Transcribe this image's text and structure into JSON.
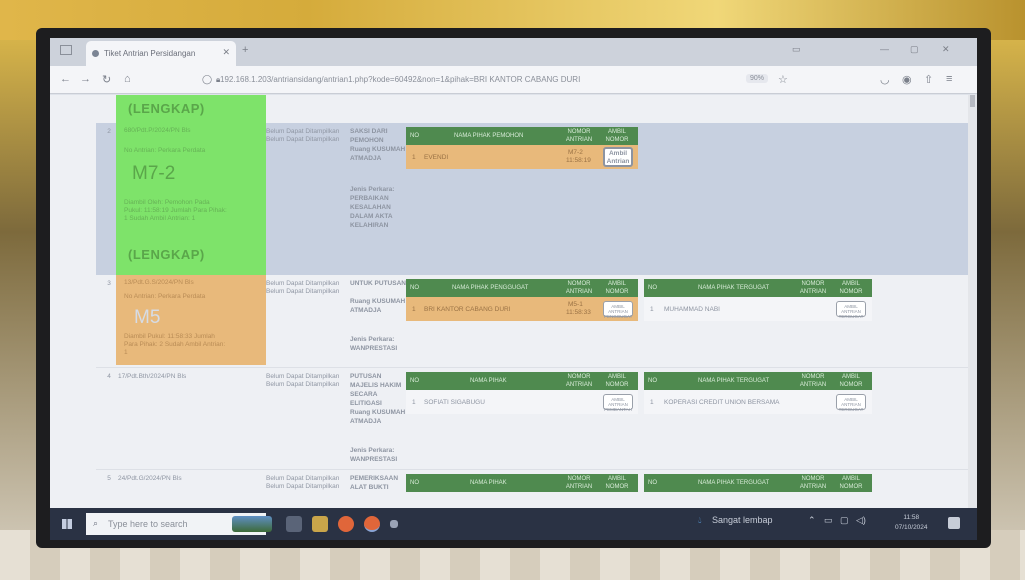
{
  "browser": {
    "tab_title": "Tiket Antrian Persidangan",
    "url": "192.168.1.203/antriansidang/antrian1.php?kode=60492&non=1&pihak=BRI KANTOR CABANG DURI",
    "zoom": "90%"
  },
  "rows": [
    {
      "top_lengkap": "(LENGKAP)"
    },
    {
      "num": "2",
      "case_no": "680/Pdt.P/2024/PN Bls",
      "status1": "Belum Dapat Ditampilkan",
      "status2": "Belum Dapat Ditampilkan",
      "agenda": "SAKSI DARI PEMOHON",
      "ruang": "Ruang KUSUMAH ATMADJA",
      "jenis_label": "Jenis Perkara:",
      "jenis": "PERBAIKAN KESALAHAN DALAM AKTA KELAHIRAN",
      "card_title": "No Antrian: Perkara Perdata",
      "card_code": "M7-2",
      "card_detail": "Diambil Oleh: Pemohon Pada Pukul: 11:58:19 Jumlah Para Pihak: 1 Sudah Ambil Antrian: 1",
      "card_lengkap": "(LENGKAP)",
      "party": {
        "head_no": "NO",
        "head_name": "NAMA PIHAK PEMOHON",
        "head_nomor": "NOMOR ANTRIAN",
        "head_ambil": "AMBIL NOMOR",
        "row_no": "1",
        "row_name": "EVENDI",
        "row_nomor": "M7-2",
        "row_time": "11:58:19",
        "button": "Ambil Antrian"
      }
    },
    {
      "num": "3",
      "case_no": "13/Pdt.G.S/2024/PN Bls",
      "status1": "Belum Dapat Ditampilkan",
      "status2": "Belum Dapat Ditampilkan",
      "agenda": "UNTUK PUTUSAN",
      "ruang": "Ruang KUSUMAH ATMADJA",
      "jenis_label": "Jenis Perkara:",
      "jenis": "WANPRESTASI",
      "card_title": "No Antrian: Perkara Perdata",
      "card_code": "M5",
      "card_detail": "Diambil Pukul: 11:58:33 Jumlah Para Pihak: 2 Sudah Ambil Antrian: 1",
      "left_party": {
        "head_no": "NO",
        "head_name": "NAMA PIHAK PENGGUGAT",
        "head_nomor": "NOMOR ANTRIAN",
        "head_ambil": "AMBIL NOMOR",
        "row_no": "1",
        "row_name": "BRI KANTOR CABANG DURI",
        "row_nomor": "M5-1",
        "row_time": "11:58:33",
        "button": "AMBIL ANTRIAN PENGGUGAT"
      },
      "right_party": {
        "head_no": "NO",
        "head_name": "NAMA PIHAK TERGUGAT",
        "head_nomor": "NOMOR ANTRIAN",
        "head_ambil": "AMBIL NOMOR",
        "row_no": "1",
        "row_name": "MUHAMMAD NABI",
        "button": "AMBIL ANTRIAN TERGUGAT"
      }
    },
    {
      "num": "4",
      "case_no": "17/Pdt.Bth/2024/PN Bls",
      "status1": "Belum Dapat Ditampilkan",
      "status2": "Belum Dapat Ditampilkan",
      "agenda": "PUTUSAN MAJELIS HAKIM SECARA ELITIGASI",
      "ruang": "Ruang KUSUMAH ATMADJA",
      "jenis_label": "Jenis Perkara:",
      "jenis": "WANPRESTASI",
      "left_party": {
        "head_no": "NO",
        "head_name": "NAMA PIHAK",
        "head_nomor": "NOMOR ANTRIAN",
        "head_ambil": "AMBIL NOMOR",
        "row_no": "1",
        "row_name": "SOFIATI SIGABUGU",
        "button": "AMBIL ANTRIAN PEMBANTAH"
      },
      "right_party": {
        "head_no": "NO",
        "head_name": "NAMA PIHAK TERGUGAT",
        "head_nomor": "NOMOR ANTRIAN",
        "head_ambil": "AMBIL NOMOR",
        "row_no": "1",
        "row_name": "KOPERASI CREDIT UNION BERSAMA",
        "button": "AMBIL ANTRIAN TERGUGAT"
      }
    },
    {
      "num": "5",
      "case_no": "24/Pdt.G/2024/PN Bls",
      "status1": "Belum Dapat Ditampilkan",
      "status2": "Belum Dapat Ditampilkan",
      "agenda": "PEMERIKSAAN ALAT BUKTI",
      "left_party": {
        "head_no": "NO",
        "head_name": "NAMA PIHAK",
        "head_nomor": "NOMOR ANTRIAN",
        "head_ambil": "AMBIL NOMOR"
      },
      "right_party": {
        "head_no": "NO",
        "head_name": "NAMA PIHAK TERGUGAT",
        "head_nomor": "NOMOR ANTRIAN",
        "head_ambil": "AMBIL NOMOR"
      }
    }
  ],
  "taskbar": {
    "search_placeholder": "Type here to search",
    "weather": "Sangat lembap",
    "time": "11:58",
    "date": "07/10/2024"
  },
  "colors": {
    "green_card": "#7ee36a",
    "orange_card": "#e8b97b",
    "table_header": "#4f8a4f",
    "highlight_row": "#e8b97b"
  }
}
